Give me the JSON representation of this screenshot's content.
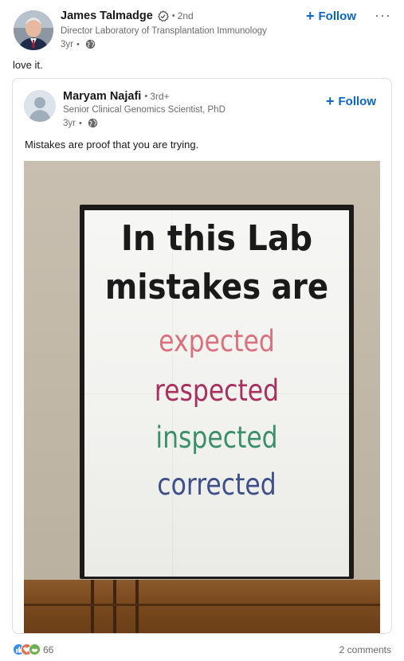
{
  "post": {
    "author": {
      "name": "James Talmadge",
      "degree": "2nd",
      "headline": "Director Laboratory of Transplantation Immunology",
      "time": "3yr",
      "visibility_icon": "globe-icon",
      "verified_icon": "verified-badge-icon"
    },
    "follow_label": "Follow",
    "more_icon": "more-options-icon",
    "more_label": "···",
    "commentary": "love it."
  },
  "reshared_post": {
    "author": {
      "name": "Maryam Najafi",
      "degree": "3rd+",
      "headline": "Senior Clinical Genomics Scientist, PhD",
      "time": "3yr",
      "visibility_icon": "globe-icon"
    },
    "follow_label": "Follow",
    "commentary": "Mistakes are proof that you are trying.",
    "image": {
      "poster_lines": [
        "In this Lab",
        "mistakes are",
        "expected",
        "respected",
        "inspected",
        "corrected"
      ],
      "colors": {
        "black": "#1a1a1a",
        "pink": "#d9727e",
        "magenta": "#a8305e",
        "green": "#3c9069",
        "blue": "#3f4f8a"
      }
    }
  },
  "social": {
    "reaction_icons": [
      "like-icon",
      "love-icon",
      "support-icon"
    ],
    "reaction_count": "66",
    "comments": "2 comments"
  },
  "colors": {
    "accent": "#0a66c2",
    "secondary_text": "rgba(0,0,0,0.6)",
    "border": "#e0dfdc"
  }
}
